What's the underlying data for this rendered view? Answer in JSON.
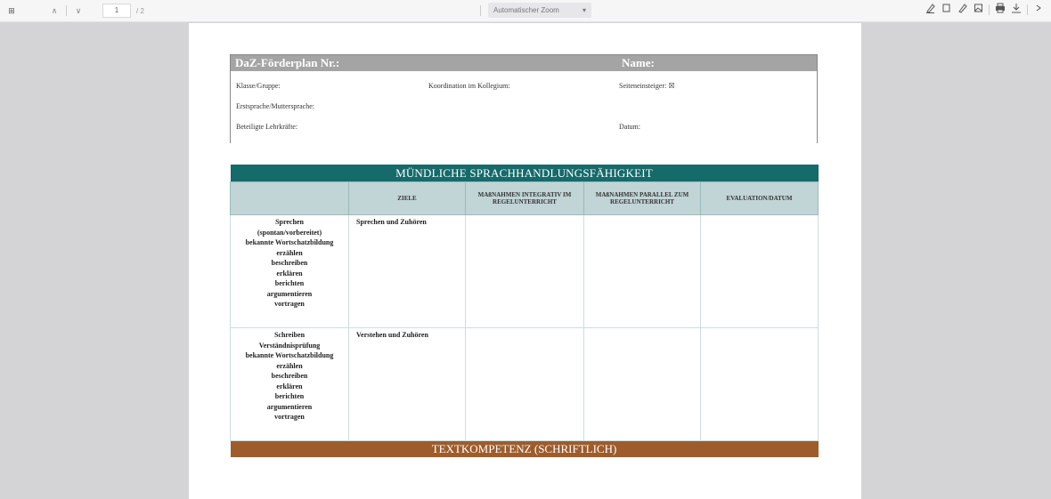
{
  "toolbar": {
    "sidebar_label": "⊞",
    "prev": "∧",
    "next": "∨",
    "page_current": "1",
    "page_count": "/ 2",
    "zoom_value": "Automatischer Zoom",
    "zoom_arrow": "▾"
  },
  "document": {
    "header": {
      "title": "DaZ-Förderplan Nr.:",
      "name_label": "Name:",
      "lerngruppe": "Klasse/Gruppe:",
      "koordination": "Koordination im Kollegium:",
      "seiteneinsteiger": "Seiteneinsteiger: ☒",
      "erstsprache": "Erstsprache/Muttersprache:",
      "beteiligte": "Beteiligte Lehrkräfte:",
      "datum": "Datum:"
    },
    "section1_title": "MÜNDLICHE SPRACHHANDLUNGSFÄHIGKEIT",
    "columns": [
      "",
      "ZIELE",
      "MAßNAHMEN INTEGRATIV IM REGELUNTERRICHT",
      "MAßNAHMEN PARALLEL ZUM REGELUNTERRICHT",
      "EVALUATION/DATUM"
    ],
    "rows": [
      {
        "label_lines": [
          "Sprechen",
          "(spontan/vorbereitet)",
          "bekannte Wortschatzbildung",
          "erzählen",
          "beschreiben",
          "erklären",
          "berichten",
          "argumentieren",
          "vortragen"
        ],
        "ziel": "Sprechen und Zuhören"
      },
      {
        "label_lines": [
          "Schreiben",
          "Verständnisprüfung",
          "bekannte Wortschatzbildung",
          "erzählen",
          "beschreiben",
          "erklären",
          "berichten",
          "argumentieren",
          "vortragen"
        ],
        "ziel": "Verstehen und Zuhören"
      }
    ],
    "section2_title": "TEXTKOMPETENZ (SCHRIFTLICH)"
  },
  "colors": {
    "teal": "#156a6a",
    "brown": "#9d5c2c",
    "header_gray": "#a4a4a4",
    "col_header_bg": "#c1d4d6"
  }
}
